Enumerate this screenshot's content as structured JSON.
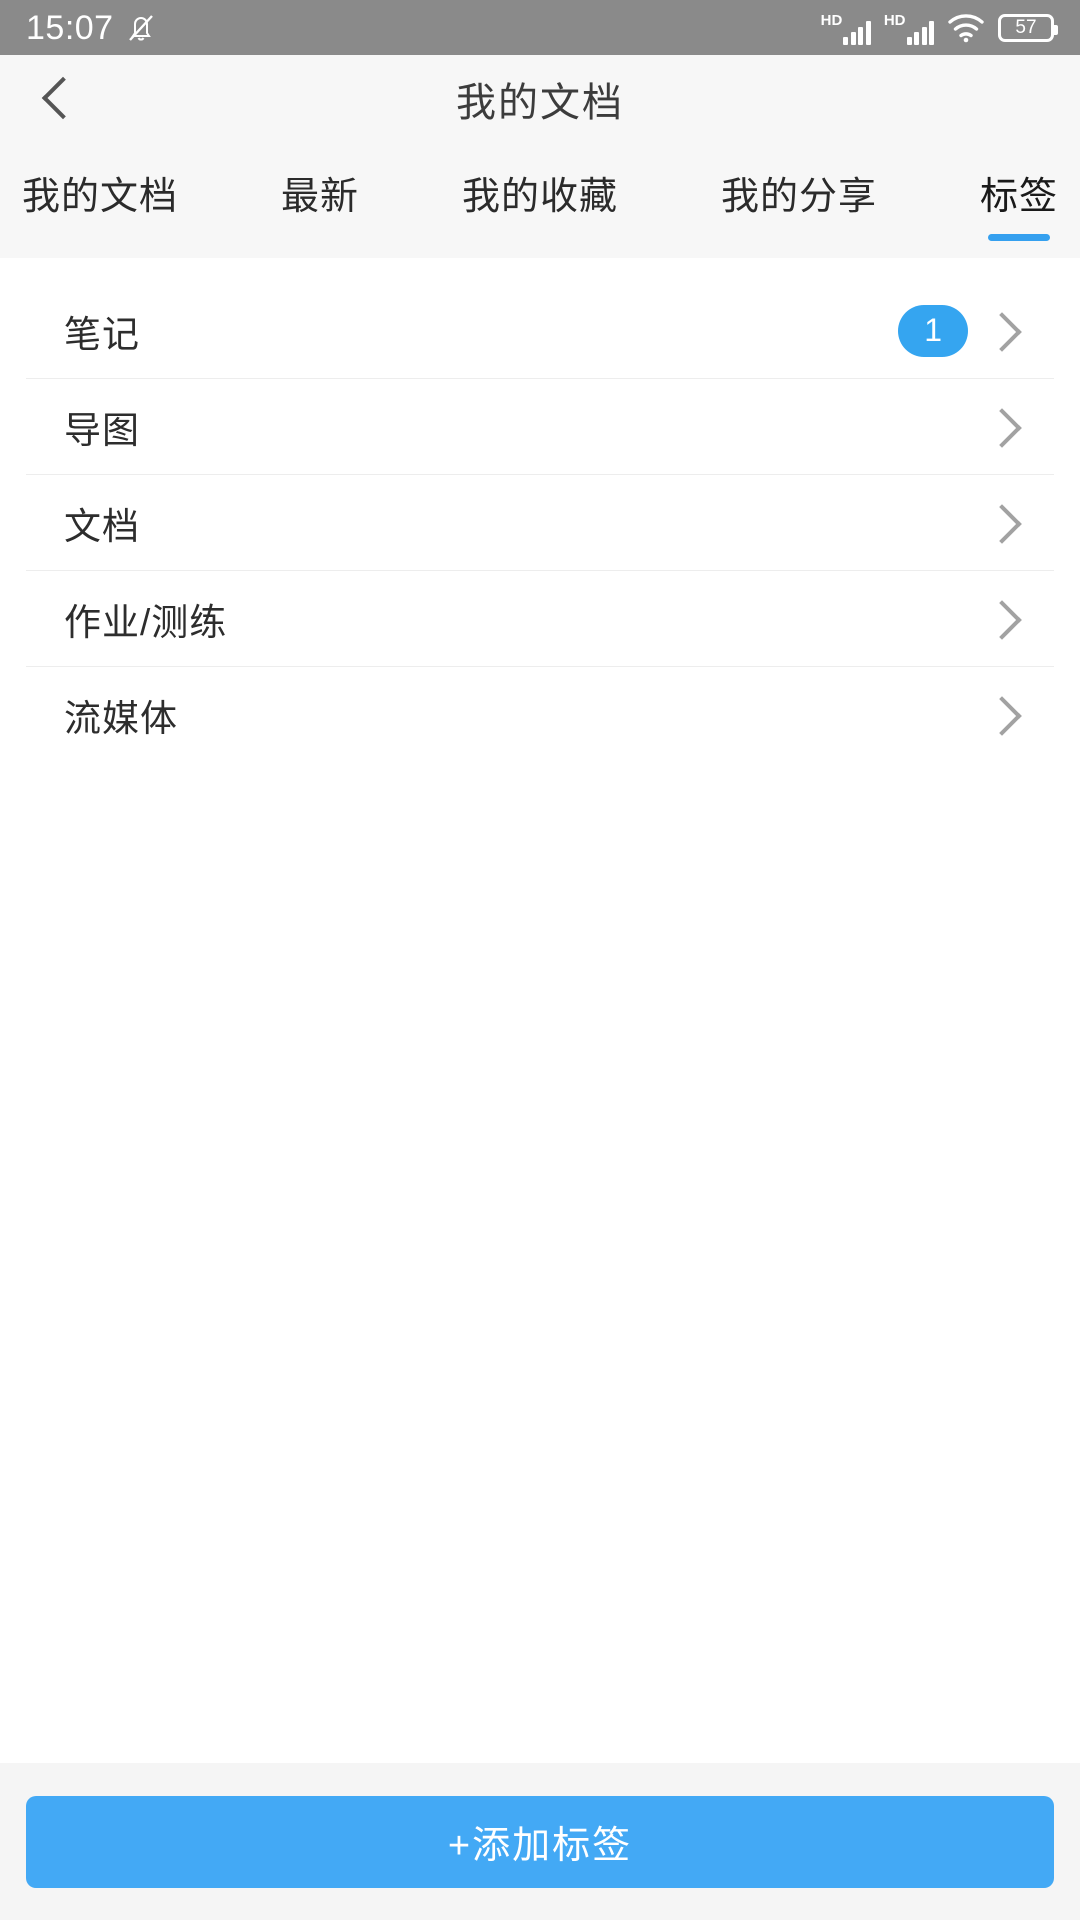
{
  "status_bar": {
    "time": "15:07",
    "mute_icon": "bell-muted-icon",
    "network_labels": [
      "HD",
      "HD"
    ],
    "wifi_icon": "wifi-icon",
    "battery_level": "57"
  },
  "header": {
    "back_icon": "chevron-left-icon",
    "title": "我的文档"
  },
  "tabs": [
    {
      "label": "我的文档",
      "active": false
    },
    {
      "label": "最新",
      "active": false
    },
    {
      "label": "我的收藏",
      "active": false
    },
    {
      "label": "我的分享",
      "active": false
    },
    {
      "label": "标签",
      "active": true
    }
  ],
  "tag_list": [
    {
      "label": "笔记",
      "count": "1"
    },
    {
      "label": "导图",
      "count": ""
    },
    {
      "label": "文档",
      "count": ""
    },
    {
      "label": "作业/测练",
      "count": ""
    },
    {
      "label": "流媒体",
      "count": ""
    }
  ],
  "footer": {
    "add_tag_label": "+添加标签"
  },
  "colors": {
    "accent": "#35a5f0",
    "button": "#43a9f5",
    "status_bar_bg": "#8a8a8a",
    "header_bg": "#f7f7f7",
    "page_bg": "#f5f5f5"
  }
}
